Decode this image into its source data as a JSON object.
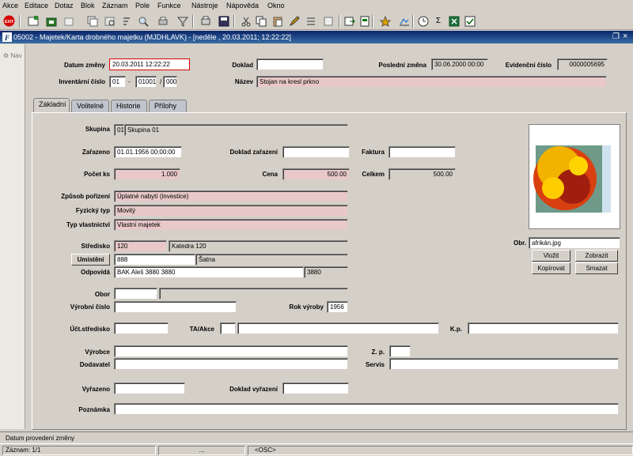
{
  "menu": [
    "Akce",
    "Editace",
    "Dotaz",
    "Blok",
    "Záznam",
    "Pole",
    "Funkce",
    "Nástroje",
    "Nápověda",
    "Okno"
  ],
  "toolbar": {
    "icons": [
      "exit-icon",
      "new-record-icon",
      "insert-icon",
      "delete-icon",
      "copy-record-icon",
      "query-icon",
      "filter-icon",
      "sort-icon",
      "print-icon",
      "save-icon",
      "cut-icon",
      "copy-icon",
      "paste-icon",
      "edit-icon",
      "list-icon",
      "clear-icon",
      "export-icon",
      "attach-icon",
      "pin-icon",
      "chart-icon",
      "clock-icon",
      "sum-icon",
      "excel-icon",
      "check-icon"
    ],
    "exit_label": "EXIT"
  },
  "window": {
    "title": "05002 - Majetek/Karta drobného majetku (MJDHLAVK) - [neděle , 20.03.2011; 12:22:22]"
  },
  "nav": {
    "label": "Nav"
  },
  "header": {
    "datum_zmeny_label": "Datum změny",
    "datum_zmeny_value": "20.03.2011 12:22:22",
    "doklad_label": "Doklad",
    "doklad_value": "",
    "posledni_zmena_label": "Poslední změna",
    "posledni_zmena_value": "30.06.2000 00:00",
    "evidencni_cislo_label": "Evidenční číslo",
    "evidencni_cislo_value": "0000005695",
    "inventarni_cislo_label": "Inventární číslo",
    "inv_part1": "01",
    "inv_dash": "-",
    "inv_part2": "01001",
    "inv_slash": "/",
    "inv_part3": "000",
    "nazev_label": "Název",
    "nazev_value": "Stojan na kresl prkno"
  },
  "tabs": [
    {
      "label": "Základní",
      "active": true
    },
    {
      "label": "Volitelné",
      "active": false
    },
    {
      "label": "Historie",
      "active": false
    },
    {
      "label": "Přílohy",
      "active": false
    }
  ],
  "form": {
    "skupina_label": "Skupina",
    "skupina_code": "01",
    "skupina_name": "Skupina 01",
    "zarazeno_label": "Zařazeno",
    "zarazeno_value": "01.01.1956 00:00:00",
    "doklad_zarazeni_label": "Doklad zařazení",
    "doklad_zarazeni_value": "",
    "faktura_label": "Faktura",
    "faktura_value": "",
    "pocet_ks_label": "Počet ks",
    "pocet_ks_value": "1.000",
    "cena_label": "Cena",
    "cena_value": "500.00",
    "celkem_label": "Celkem",
    "celkem_value": "500.00",
    "zpusob_porizeni_label": "Způsob pořízení",
    "zpusob_porizeni_value": "Úplatné nabytí (investice)",
    "fyzicky_typ_label": "Fyzický typ",
    "fyzicky_typ_value": "Movitý",
    "typ_vlastnictvi_label": "Typ vlastnictví",
    "typ_vlastnictvi_value": "Vlastní majetek",
    "stredisko_label": "Středisko",
    "stredisko_code": "120",
    "stredisko_name": "Katedra 120",
    "umisteni_label": "Umístění",
    "umisteni_code": "888",
    "umisteni_name": "Šatna",
    "odpovida_label": "Odpovídá",
    "odpovida_value": "BAK Aleš 3880 3880",
    "odpovida_code": "3880",
    "obor_label": "Obor",
    "obor_code": "",
    "obor_name": "",
    "vyrobni_cislo_label": "Výrobní číslo",
    "vyrobni_cislo_value": "",
    "rok_vyroby_label": "Rok výroby",
    "rok_vyroby_value": "1956",
    "uct_stredisko_label": "Účt.středisko",
    "uct_stredisko_value": "",
    "ta_akce_label": "TA/Akce",
    "ta_akce_code": "",
    "ta_akce_name": "",
    "kp_label": "K.p.",
    "kp_value": "",
    "vyrobce_label": "Výrobce",
    "vyrobce_value": "",
    "zp_label": "Z. p.",
    "zp_value": "",
    "dodavatel_label": "Dodavatel",
    "dodavatel_value": "",
    "servis_label": "Servis",
    "servis_value": "",
    "vyrazeno_label": "Vyřazeno",
    "vyrazeno_value": "",
    "doklad_vyrazeni_label": "Doklad vyřazení",
    "doklad_vyrazeni_value": "",
    "poznamka_label": "Poznámka",
    "poznamka_value": ""
  },
  "image_panel": {
    "obr_label": "Obr.",
    "obr_value": "afrikán.jpg",
    "vlozit_label": "Vložit",
    "zobrazit_label": "Zobrazit",
    "kopirovat_label": "Kopírovat",
    "smazat_label": "Smazat"
  },
  "status": {
    "hint": "Datum provedení změny",
    "record": "Záznam: 1/1",
    "ellipsis": "...",
    "osc": "<OSC>"
  },
  "colors": {
    "title_bar": "#0a246a",
    "required_field": "#e8c8c8",
    "focus_border": "#e00000"
  }
}
